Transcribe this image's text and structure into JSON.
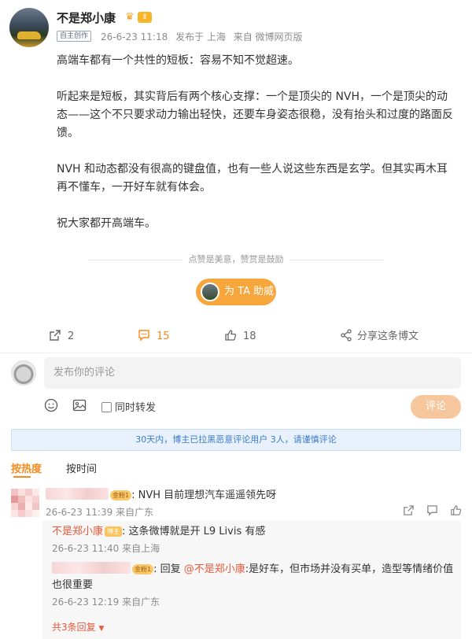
{
  "post": {
    "author": "不是郑小康",
    "vip_badge": "Ⅱ",
    "original_tag": "自主创作",
    "timestamp": "26-6-23 11:18",
    "location": "发布于 上海",
    "source": "来自 微博网页版",
    "paragraphs": [
      "高端车都有一个共性的短板：容易不知不觉超速。",
      "听起来是短板，其实背后有两个核心支撑：一个是顶尖的 NVH，一个是顶尖的动态——这个不只要求动力输出轻快，还要车身姿态很稳，没有抬头和过度的路面反馈。",
      "NVH 和动态都没有很高的键盘值，也有一些人说这些东西是玄学。但其实再木耳再不懂车，一开好车就有体会。",
      "祝大家都开高端车。"
    ],
    "like_hint": "点赞是美意，赞赏是鼓励",
    "support_button": "为 TA 助威"
  },
  "actions": {
    "repost_count": "2",
    "comment_count": "15",
    "like_count": "18",
    "share_label": "分享这条博文"
  },
  "composer": {
    "placeholder": "发布你的评论",
    "repost_checkbox_label": "同时转发",
    "submit_label": "评论"
  },
  "notice": "30天内，博主已拉黑恶意评论用户 3人，请谨慎评论",
  "sort": {
    "hot": "按热度",
    "time": "按时间"
  },
  "comments": [
    {
      "fan_badge": "金粉1",
      "text": ": NVH 目前理想汽车遥遥领先呀",
      "time": "26-6-23 11:39",
      "location": "来自广东"
    }
  ],
  "replies": [
    {
      "author": "不是郑小康",
      "badge": "博主",
      "text": ": 这条微博就是开 L9 Livis 有感",
      "time": "26-6-23 11:40",
      "location": "来自上海"
    },
    {
      "fan_badge": "金粉1",
      "prefix": ": 回复 ",
      "mention": "@不是郑小康",
      "text": ":是好车，但市场并没有买单，造型等情绪价值也很重要",
      "time": "26-6-23 12:19",
      "location": "来自广东"
    }
  ],
  "more_replies": "共3条回复",
  "colors": {
    "accent": "#f78a1e",
    "support_button": "#f7a63b",
    "name_red": "#e8593b",
    "notice_bg": "#e9f2fc"
  }
}
